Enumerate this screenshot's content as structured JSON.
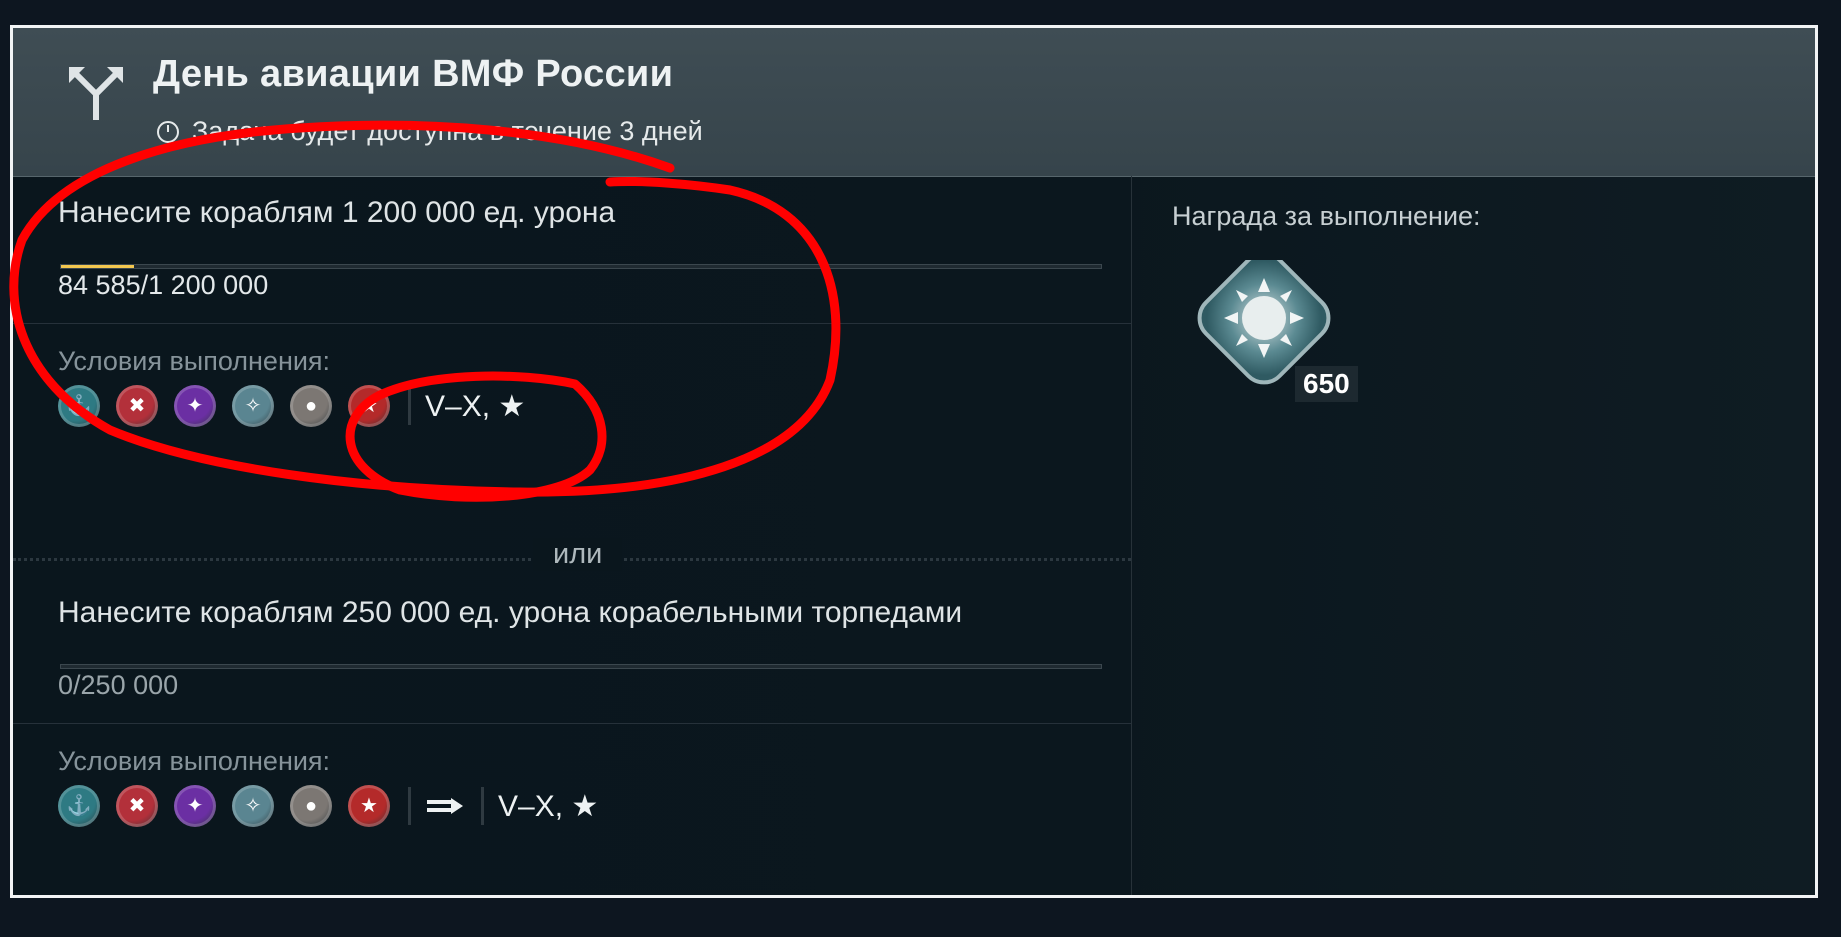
{
  "header": {
    "title": "День авиации ВМФ России",
    "subtitle": "Задача будет доступна в течение 3 дней"
  },
  "task1": {
    "title": "Нанесите кораблям 1 200 000 ед. урона",
    "progress_current": "84 585",
    "progress_total": "/1 200 000",
    "progress_fraction": 0.0705,
    "conditions_label": "Условия выполнения:",
    "tiers": "V–X, ★"
  },
  "or_label": "или",
  "task2": {
    "title": "Нанесите кораблям 250 000 ед. урона корабельными торпедами",
    "progress_current": "0",
    "progress_total": "/250 000",
    "progress_fraction": 0,
    "conditions_label": "Условия выполнения:",
    "tiers": "V–X, ★"
  },
  "ship_classes": [
    {
      "icon": "aircraft-carrier-icon",
      "color": "#2e7a83"
    },
    {
      "icon": "battleship-icon",
      "color": "#b3303a"
    },
    {
      "icon": "cruiser-icon",
      "color": "#6b2fa3"
    },
    {
      "icon": "destroyer-icon",
      "color": "#5a8591"
    },
    {
      "icon": "submarine-icon",
      "color": "#7c7773"
    },
    {
      "icon": "premium-ship-icon",
      "color": "#b42a2a"
    }
  ],
  "reward": {
    "label": "Награда за выполнение:",
    "icon": "coal-container-icon",
    "count": "650"
  },
  "colors": {
    "progress_fill": "#f3c74f",
    "annotation": "#ff0000"
  }
}
